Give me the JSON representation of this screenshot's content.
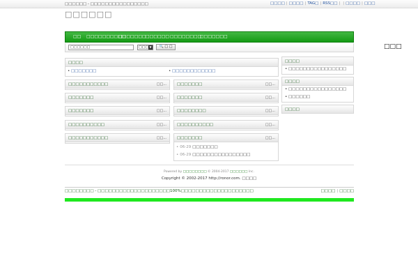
{
  "topbar": {
    "left_text": "□□□□□□ - □□□□□□□□□□□□□□□□",
    "links": [
      "□□□□",
      "□□□□",
      "TAG□",
      "RSS□□",
      "□□□□",
      "□□□"
    ]
  },
  "logo": {
    "text": "□□□□□□"
  },
  "nav": {
    "items": [
      "□□",
      "□□□□□□□□□□",
      "□□□□□□□",
      "□□□□□□",
      "□□□□□□□□",
      "□□□□□□□"
    ]
  },
  "search": {
    "placeholder": "□□□□□□",
    "select_value": "□□□",
    "caret": "▼",
    "button_label": "🔍 □ □",
    "right_label": "□□□"
  },
  "announce": {
    "title": "□□□□",
    "items": [
      "□□□□□□□",
      "□□□□□□□□□□□□"
    ]
  },
  "left_boxes": [
    {
      "title": "□□□□□□□□□□□",
      "more": "□□..."
    },
    {
      "title": "□□□□□□□",
      "more": "□□..."
    },
    {
      "title": "□□□□□□□",
      "more": "□□..."
    },
    {
      "title": "□□□□□□□□□□",
      "more": "□□..."
    },
    {
      "title": "□□□□□□□□□□□",
      "more": "□□..."
    }
  ],
  "mid_boxes": [
    {
      "title": "□□□□□□□",
      "more": "□□..."
    },
    {
      "title": "□□□□□□□",
      "more": "□□..."
    },
    {
      "title": "□□□□□□□□",
      "more": "□□..."
    },
    {
      "title": "□□□□□□□□□□",
      "more": "□□..."
    },
    {
      "title": "□□□□□□□",
      "more": "□□...",
      "news": [
        {
          "date": "06-29",
          "text": "□□□□□□□"
        },
        {
          "date": "06-29",
          "text": "□□□□□□□□□□□□□□□□"
        }
      ]
    }
  ],
  "sidebar": {
    "box1": {
      "title": "□□□□",
      "items": [
        "□□□□□□□□□□□□□□□□"
      ]
    },
    "box2": {
      "title": "□□□□",
      "items": [
        "□□□□□□□□□□□□□□□□",
        "□□□□□□"
      ]
    },
    "box3": {
      "title": "□□□□"
    }
  },
  "footer": {
    "powered_prefix": "Powered by",
    "powered_link": "□□□□□□□□",
    "powered_suffix": "© 2004-2017",
    "powered_link2": "□□□□□□",
    "powered_end": "Inc.",
    "copyright": "Copyright © 2002-2017 http://ronor.com.",
    "copyright_link": "□□□□"
  },
  "bottom": {
    "left": "□□□□□□□□ - □□□□□□□□□□□□□□□□□□□□100%□□□□□□□□□□□□□□□□□□□□",
    "links": [
      "□□□□",
      "□□□□"
    ]
  }
}
